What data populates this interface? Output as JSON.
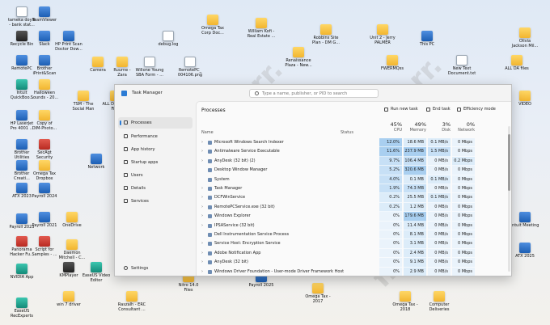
{
  "desktop_icons": [
    {
      "label": "tameka doyle\n- bank stat...",
      "kind": "doc"
    },
    {
      "label": "TeamViewer",
      "kind": "app"
    },
    {
      "label": "Recycle Bin",
      "kind": "dark"
    },
    {
      "label": "Slack",
      "kind": "app"
    },
    {
      "label": "HP Print Scan\nDoctor Dow...",
      "kind": "app"
    },
    {
      "label": "debug.log",
      "kind": "doc"
    },
    {
      "label": "Omega Tax\nCorp Doc...",
      "kind": "folder"
    },
    {
      "label": "William Kofi -\nReal Estate ...",
      "kind": "folder"
    },
    {
      "label": "Robbins Site\nPlan - DM G...",
      "kind": "folder"
    },
    {
      "label": "Unit 2 - Jerry\nPALMER",
      "kind": "folder"
    },
    {
      "label": "This PC",
      "kind": "app"
    },
    {
      "label": "Olivia\nJackson Mil...",
      "kind": "folder"
    },
    {
      "label": "RemotePC",
      "kind": "app"
    },
    {
      "label": "Brother\niPrint&Scan",
      "kind": "app"
    },
    {
      "label": "Camera",
      "kind": "folder"
    },
    {
      "label": "Ruurne -\nZara",
      "kind": "folder"
    },
    {
      "label": "Willone Young\nSBA Form - ...",
      "kind": "doc"
    },
    {
      "label": "RemotePC_\n004106.png",
      "kind": "doc"
    },
    {
      "label": "Renaissance\nPlaza - New...",
      "kind": "folder"
    },
    {
      "label": "FWERMQss",
      "kind": "folder"
    },
    {
      "label": "New Text\nDocument.txt",
      "kind": "doc"
    },
    {
      "label": "ALL DA files",
      "kind": "folder"
    },
    {
      "label": "Intuit\nQuickBoo...",
      "kind": "teal"
    },
    {
      "label": "Halloween\nSounds - 20...",
      "kind": "folder"
    },
    {
      "label": "TSM - The\nSocial Man",
      "kind": "folder"
    },
    {
      "label": "ALL Donovan\nFiles",
      "kind": "folder"
    },
    {
      "label": "VIDEO",
      "kind": "folder"
    },
    {
      "label": "HP LaserJet\nPro 4001 ...",
      "kind": "app"
    },
    {
      "label": "Copy of\nDIM-Photo...",
      "kind": "folder"
    },
    {
      "label": "Brother\nUtilities",
      "kind": "app"
    },
    {
      "label": "SecAgt\nSecurity",
      "kind": "pdf"
    },
    {
      "label": "Brother\nCreati...",
      "kind": "app"
    },
    {
      "label": "Omega Tax\nDropbox",
      "kind": "folder"
    },
    {
      "label": "Network",
      "kind": "app"
    },
    {
      "label": "ATX 2023",
      "kind": "app"
    },
    {
      "label": "Payroll 2024",
      "kind": "app"
    },
    {
      "label": "Payroll 2023",
      "kind": "app"
    },
    {
      "label": "Payroll 2021",
      "kind": "app"
    },
    {
      "label": "OneDrive",
      "kind": "folder"
    },
    {
      "label": "Intuit Meeting",
      "kind": "app"
    },
    {
      "label": "Panorama\nHacker Fu...",
      "kind": "pdf"
    },
    {
      "label": "Script for\nSamples - ...",
      "kind": "pdf"
    },
    {
      "label": "Daemon\nMitchell - C...",
      "kind": "folder"
    },
    {
      "label": "ATX 2025",
      "kind": "app"
    },
    {
      "label": "NVIDIA App",
      "kind": "teal"
    },
    {
      "label": "KMPlayer",
      "kind": "dark"
    },
    {
      "label": "EaseUS Video\nEditor",
      "kind": "teal"
    },
    {
      "label": "Nitro 14.0\nFiles",
      "kind": "folder"
    },
    {
      "label": "Payroll 2025",
      "kind": "app"
    },
    {
      "label": "EaseUS\nRecExperts",
      "kind": "teal"
    },
    {
      "label": "win 7 driver",
      "kind": "folder"
    },
    {
      "label": "Raszalh - ERC\nConsultant ...",
      "kind": "folder"
    },
    {
      "label": "Omega Tax -\n2017",
      "kind": "folder"
    },
    {
      "label": "Omega Tax -\n2018",
      "kind": "folder"
    },
    {
      "label": "Computer\nDeliveries",
      "kind": "folder"
    }
  ],
  "watermark": "fiverr.",
  "task_manager": {
    "title": "Task Manager",
    "search_placeholder": "Type a name, publisher, or PID to search",
    "nav": [
      "Processes",
      "Performance",
      "App history",
      "Startup apps",
      "Users",
      "Details",
      "Services"
    ],
    "settings_label": "Settings",
    "heading": "Processes",
    "toolbar": {
      "run_new_task": "Run new task",
      "end_task": "End task",
      "efficiency_mode": "Efficiency mode"
    },
    "columns": {
      "name": "Name",
      "status": "Status",
      "cpu_pct": "45%",
      "cpu": "CPU",
      "mem_pct": "49%",
      "mem": "Memory",
      "disk_pct": "3%",
      "disk": "Disk",
      "net_pct": "0%",
      "net": "Network"
    },
    "processes": [
      {
        "name": "Microsoft Windows Search Indexer",
        "cpu": "12.0%",
        "mem": "18.6 MB",
        "disk": "0.1 MB/s",
        "net": "0 Mbps",
        "expand": true
      },
      {
        "name": "Antimalware Service Executable",
        "cpu": "11.6%",
        "mem": "237.9 MB",
        "disk": "1.5 MB/s",
        "net": "0 Mbps",
        "expand": true
      },
      {
        "name": "AnyDesk (32 bit) (2)",
        "cpu": "9.7%",
        "mem": "106.4 MB",
        "disk": "0 MB/s",
        "net": "0.2 Mbps",
        "expand": true
      },
      {
        "name": "Desktop Window Manager",
        "cpu": "5.2%",
        "mem": "320.6 MB",
        "disk": "0 MB/s",
        "net": "0 Mbps",
        "expand": false
      },
      {
        "name": "System",
        "cpu": "4.0%",
        "mem": "0.1 MB",
        "disk": "0.1 MB/s",
        "net": "0 Mbps",
        "expand": false
      },
      {
        "name": "Task Manager",
        "cpu": "1.9%",
        "mem": "74.3 MB",
        "disk": "0 MB/s",
        "net": "0 Mbps",
        "expand": true
      },
      {
        "name": "DCFWinService",
        "cpu": "0.2%",
        "mem": "25.5 MB",
        "disk": "0.1 MB/s",
        "net": "0 Mbps",
        "expand": true
      },
      {
        "name": "RemotePCService.exe (32 bit)",
        "cpu": "0.2%",
        "mem": "1.2 MB",
        "disk": "0 MB/s",
        "net": "0 Mbps",
        "expand": true
      },
      {
        "name": "Windows Explorer",
        "cpu": "0%",
        "mem": "179.6 MB",
        "disk": "0 MB/s",
        "net": "0 Mbps",
        "expand": true
      },
      {
        "name": "IPSAService (32 bit)",
        "cpu": "0%",
        "mem": "11.4 MB",
        "disk": "0 MB/s",
        "net": "0 Mbps",
        "expand": true
      },
      {
        "name": "Dell Instrumentation Service Process",
        "cpu": "0%",
        "mem": "8.1 MB",
        "disk": "0 MB/s",
        "net": "0 Mbps",
        "expand": false
      },
      {
        "name": "Service Host: Encryption Service",
        "cpu": "0%",
        "mem": "3.1 MB",
        "disk": "0 MB/s",
        "net": "0 Mbps",
        "expand": true
      },
      {
        "name": "Adobe Notification App",
        "cpu": "0%",
        "mem": "2.4 MB",
        "disk": "0 MB/s",
        "net": "0 Mbps",
        "expand": true
      },
      {
        "name": "AnyDesk (32 bit)",
        "cpu": "0%",
        "mem": "9.1 MB",
        "disk": "0 MB/s",
        "net": "0 Mbps",
        "expand": true
      },
      {
        "name": "Windows Driver Foundation - User-mode Driver Framework Host Pr...",
        "cpu": "0%",
        "mem": "2.9 MB",
        "disk": "0 MB/s",
        "net": "0 Mbps",
        "expand": true
      }
    ]
  }
}
